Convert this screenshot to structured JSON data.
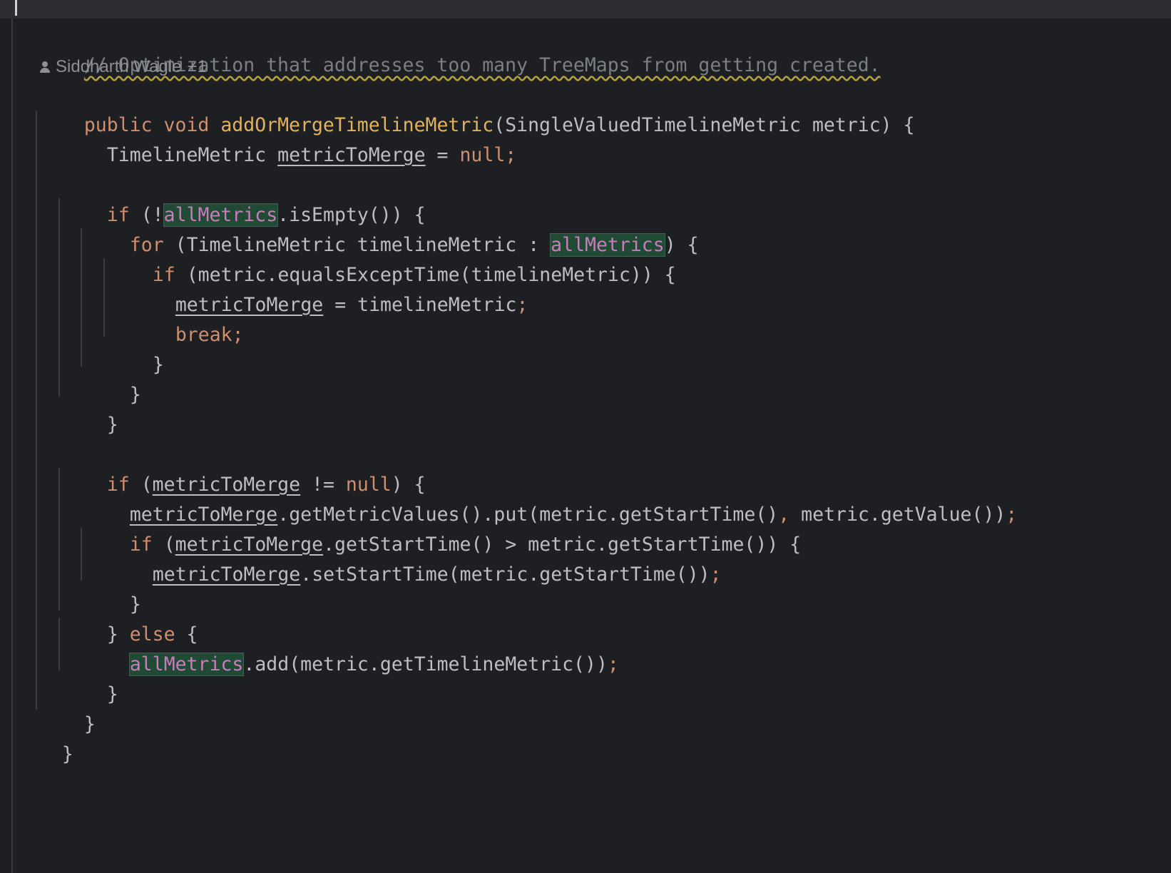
{
  "comment": "// Optimization that addresses too many TreeMaps from getting created.",
  "author": {
    "name": "Siddharth Wagle",
    "extra": "+1"
  },
  "code": {
    "sig_public": "public",
    "sig_void": "void",
    "sig_name": "addOrMergeTimelineMetric",
    "sig_rest": "(SingleValuedTimelineMetric metric) {",
    "l2_type": "TimelineMetric ",
    "var_merge": "metricToMerge",
    "l2_eq": " = ",
    "null": "null",
    "semi": ";",
    "kw_if": "if",
    "kw_for": "for",
    "kw_break": "break",
    "kw_else": "else",
    "l4_open": " (!",
    "field_all": "allMetrics",
    "l4_rest": ".isEmpty()) {",
    "l5_mid": " (TimelineMetric timelineMetric : ",
    "l5_end": ") {",
    "l6_rest": " (metric.equalsExceptTime(timelineMetric)) {",
    "l7_rest": " = timelineMetric",
    "brace_close": "}",
    "l11_open": " (",
    "l11_mid": " != ",
    "l11_end": ") {",
    "l12_a": ".getMetricValues().put(metric.getStartTime()",
    "comma": ",",
    "l12_b": " metric.getValue())",
    "l13_rest": ".getStartTime() > metric.getStartTime()) {",
    "l14_rest": ".setStartTime(metric.getStartTime())",
    "l16_open": "} ",
    "l16_end": " {",
    "l17_rest": ".add(metric.getTimelineMetric())"
  }
}
